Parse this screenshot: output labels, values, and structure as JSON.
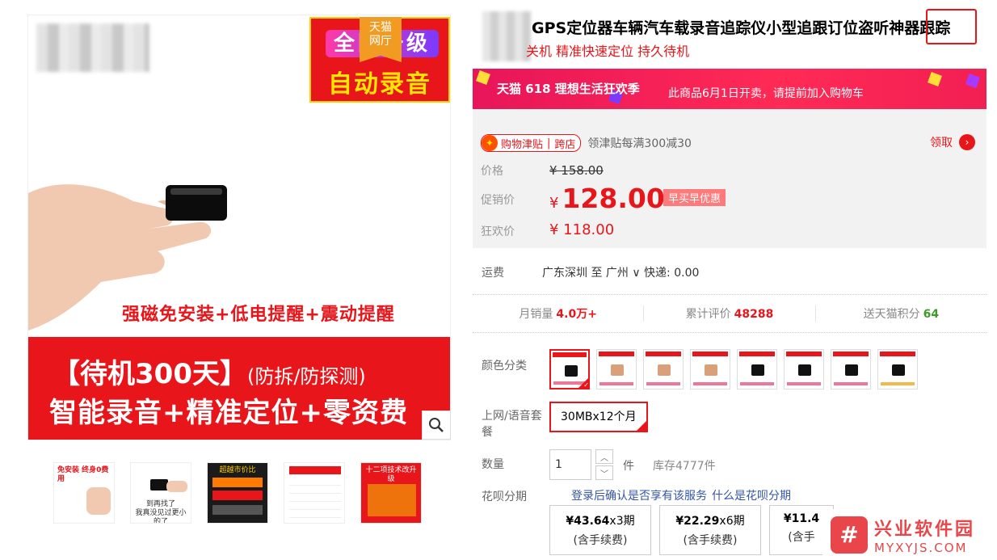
{
  "gallery": {
    "promo_line1": "全网一级",
    "promo_line2": "自动录音",
    "tmall_tag": "天猫\n网厅",
    "feature_text": "强磁免安装+低电提醒+震动提醒",
    "band_line1_big": "【待机300天】",
    "band_line1_small": "(防拆/防探测)",
    "band_line2": "智能录音+精准定位+零资费",
    "thumbs": [
      {
        "text": "免安装 终身0费用"
      },
      {
        "text": "到再找了\n我真没见过更小的了"
      },
      {
        "text": "超越市价比"
      },
      {
        "text": ""
      },
      {
        "text": "十二项技术改升级"
      }
    ]
  },
  "product": {
    "title": "GPS定位器车辆汽车载录音追踪仪小型追跟订位盗听神器跟踪",
    "subtitle": "关机 精准快速定位 持久待机"
  },
  "banner": {
    "logo": "天猫 618 理想生活狂欢季",
    "text": "此商品6月1日开卖，请提前加入购物车"
  },
  "price": {
    "subsidy_tag": "购物津贴",
    "subsidy_cross": "跨店",
    "subsidy_desc": "领津贴每满300减30",
    "claim": "领取",
    "label_price": "价格",
    "orig_price": "¥ 158.00",
    "label_promo": "促销价",
    "promo_yen": "¥",
    "promo_value": "128.00",
    "early_tag": "早买早优惠",
    "label_carnival": "狂欢价",
    "carnival_price": "¥ 118.00"
  },
  "shipping": {
    "label": "运费",
    "value": "广东深圳  至 广州 ∨  快递: 0.00"
  },
  "stats": {
    "monthly_label": "月销量",
    "monthly_value": "4.0万+",
    "reviews_label": "累计评价",
    "reviews_value": "48288",
    "points_label": "送天猫积分",
    "points_value": "64"
  },
  "options": {
    "color_label": "颜色分类",
    "plan_label": "上网/语音套餐",
    "plan_value": "30MBx12个月",
    "qty_label": "数量",
    "qty_value": "1",
    "unit": "件",
    "stock": "库存4777件",
    "huabei_label": "花呗分期",
    "huabei_note": "登录后确认是否享有该服务",
    "huabei_link": "什么是花呗分期",
    "huabei_plans": [
      {
        "amount": "¥43.64",
        "periods": "x3期",
        "fee": "(含手续费)"
      },
      {
        "amount": "¥22.29",
        "periods": "x6期",
        "fee": "(含手续费)"
      },
      {
        "amount": "¥11.4",
        "periods": "",
        "fee": "(含手"
      }
    ]
  },
  "watermark": {
    "line1": "兴业软件园",
    "line2": "MYXYJS.COM"
  },
  "colors": {
    "accent": "#e8151a",
    "banner": "#ff2a55",
    "green": "#3b9e27"
  }
}
